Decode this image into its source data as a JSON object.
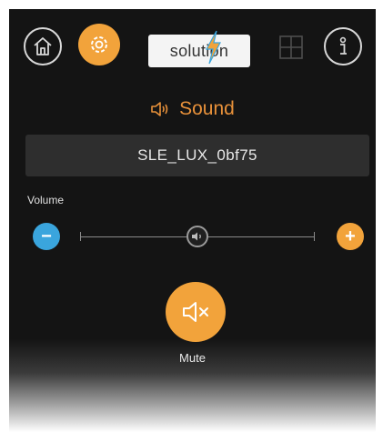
{
  "header": {
    "logo_text": "solution",
    "icons": {
      "home": "home-icon",
      "settings": "gear-icon",
      "grid": "grid-icon",
      "info": "info-icon"
    }
  },
  "title": {
    "text": "Sound",
    "icon": "speaker-icon"
  },
  "device": {
    "name": "SLE_LUX_0bf75"
  },
  "volume": {
    "label": "Volume",
    "level": 0.5,
    "minus_label": "−",
    "plus_label": "+"
  },
  "mute": {
    "label": "Mute",
    "icon": "mute-icon"
  },
  "colors": {
    "accent": "#f2a33b",
    "blue": "#3aa5dd",
    "background": "#141414"
  }
}
